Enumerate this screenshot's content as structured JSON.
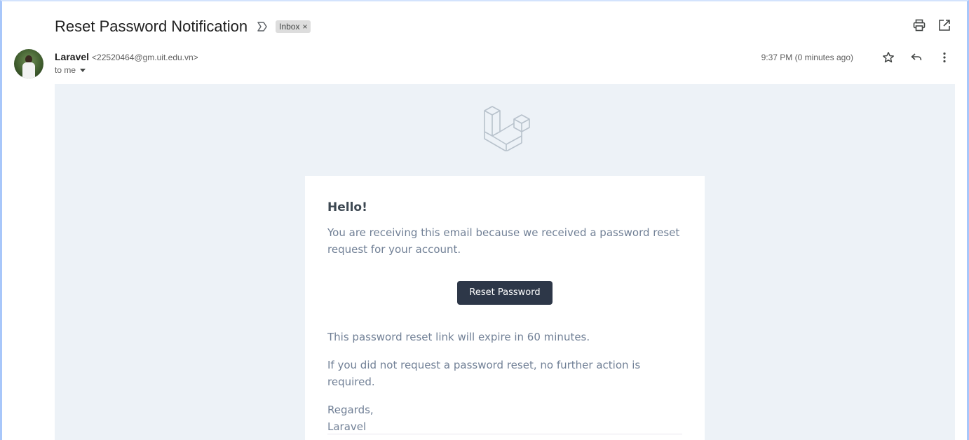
{
  "subject": "Reset Password Notification",
  "label": {
    "name": "Inbox",
    "remove": "×"
  },
  "toolbar": {
    "print_icon": "print-icon",
    "open_new_window_icon": "open-in-new-icon"
  },
  "sender": {
    "name": "Laravel",
    "email": "<22520464@gm.uit.edu.vn>",
    "to": "to me"
  },
  "timestamp": "9:37 PM (0 minutes ago)",
  "actions": {
    "star_icon": "star-icon",
    "reply_icon": "reply-icon",
    "more_icon": "more-vert-icon"
  },
  "email": {
    "greeting": "Hello!",
    "intro": "You are receiving this email because we received a password reset request for your account.",
    "button_label": "Reset Password",
    "expire": "This password reset link will expire in 60 minutes.",
    "no_action": "If you did not request a password reset, no further action is required.",
    "regards": "Regards,",
    "signature": "Laravel"
  },
  "colors": {
    "body_bg": "#edf2f7",
    "button_bg": "#2d3748",
    "text_muted": "#718096",
    "heading": "#3d4852"
  }
}
